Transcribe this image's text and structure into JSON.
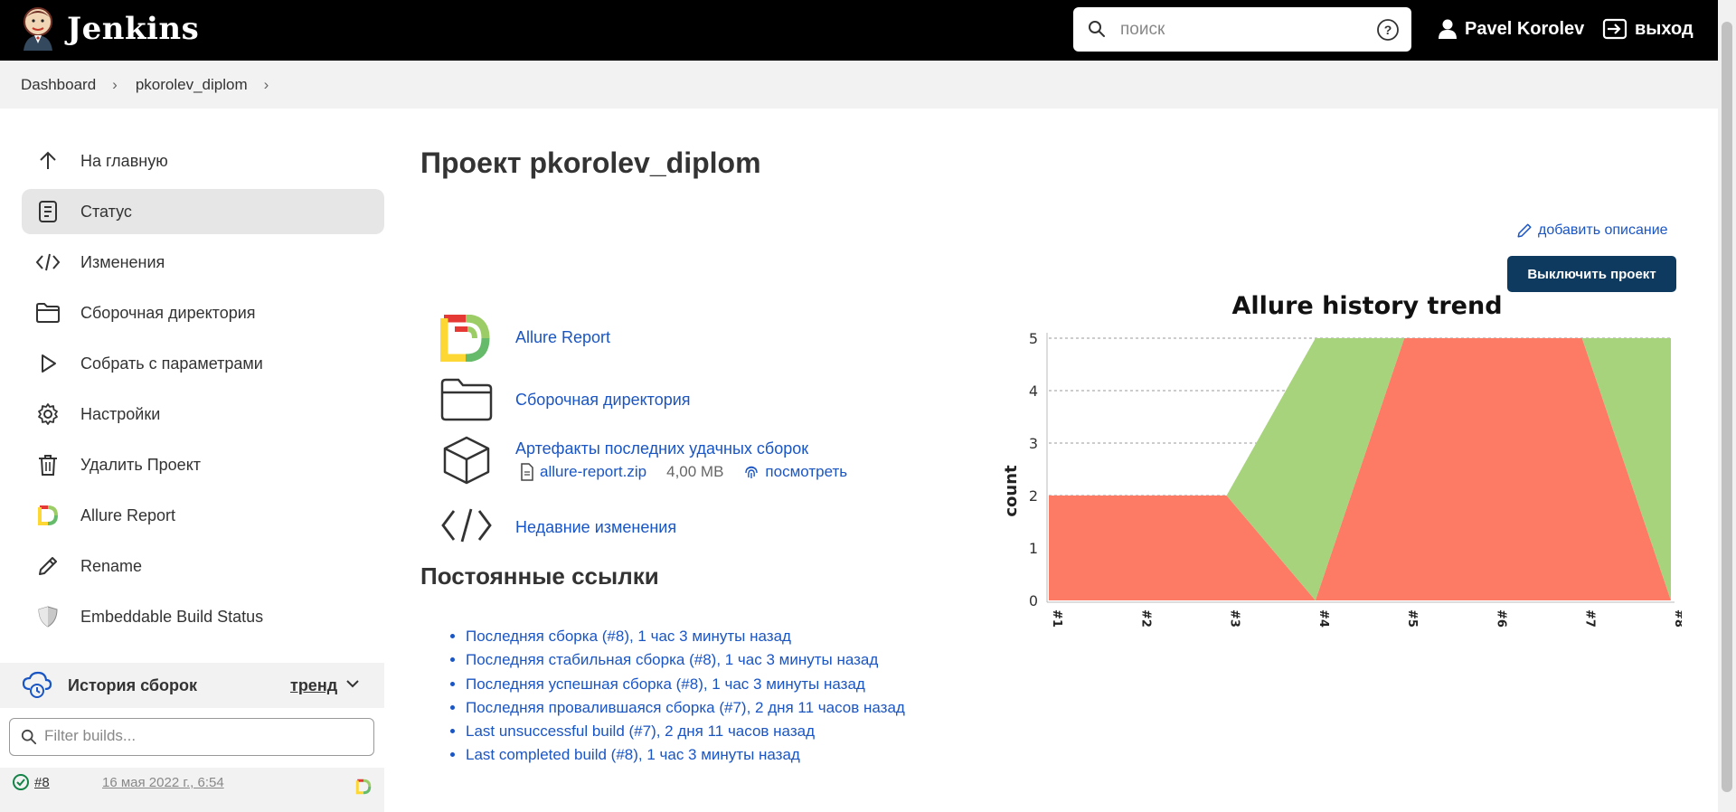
{
  "header": {
    "app_name": "Jenkins",
    "search_placeholder": "поиск",
    "user_name": "Pavel Korolev",
    "logout_label": "выход"
  },
  "breadcrumb": {
    "items": [
      "Dashboard",
      "pkorolev_diplom"
    ]
  },
  "sidebar": {
    "items": [
      {
        "label": "На главную",
        "icon": "arrow-up-icon"
      },
      {
        "label": "Статус",
        "icon": "document-icon"
      },
      {
        "label": "Изменения",
        "icon": "code-icon"
      },
      {
        "label": "Сборочная директория",
        "icon": "folder-icon"
      },
      {
        "label": "Собрать с параметрами",
        "icon": "play-icon"
      },
      {
        "label": "Настройки",
        "icon": "gear-icon"
      },
      {
        "label": "Удалить Проект",
        "icon": "trash-icon"
      },
      {
        "label": "Allure Report",
        "icon": "allure-icon"
      },
      {
        "label": "Rename",
        "icon": "pencil-icon"
      },
      {
        "label": "Embeddable Build Status",
        "icon": "shield-icon"
      }
    ],
    "history": {
      "title": "История сборок",
      "trend_label": "тренд",
      "filter_placeholder": "Filter builds...",
      "builds": [
        {
          "number": "#8",
          "date": "16 мая 2022 г., 6:54"
        }
      ]
    }
  },
  "main": {
    "title": "Проект pkorolev_diplom",
    "add_description": "добавить описание",
    "disable_button": "Выключить проект",
    "links": [
      {
        "label": "Allure Report",
        "icon": "allure-icon"
      },
      {
        "label": "Сборочная директория",
        "icon": "folder-icon"
      },
      {
        "label": "Артефакты последних удачных сборок",
        "icon": "package-icon"
      },
      {
        "label": "Недавние изменения",
        "icon": "code-icon"
      }
    ],
    "artifact": {
      "file": "allure-report.zip",
      "size": "4,00 MB",
      "view_label": "посмотреть"
    },
    "permalinks_title": "Постоянные ссылки",
    "permalinks": [
      "Последняя сборка (#8), 1 час 3 минуты назад",
      "Последняя стабильная сборка (#8), 1 час 3 минуты назад",
      "Последняя успешная сборка (#8), 1 час 3 минуты назад",
      "Последняя провалившаяся сборка (#7), 2 дня 11 часов назад",
      "Last unsuccessful build (#7), 2 дня 11 часов назад",
      "Last completed build (#8), 1 час 3 минуты назад"
    ]
  },
  "chart_data": {
    "type": "area",
    "title": "Allure history trend",
    "xlabel": "",
    "ylabel": "count",
    "categories": [
      "#1",
      "#2",
      "#3",
      "#4",
      "#5",
      "#6",
      "#7",
      "#8"
    ],
    "ylim": [
      0,
      5
    ],
    "yticks": [
      0,
      1,
      2,
      3,
      4,
      5
    ],
    "grid": true,
    "stacked": true,
    "series": [
      {
        "color": "#fd7b65",
        "values": [
          2,
          2,
          2,
          0,
          5,
          5,
          5,
          0
        ]
      },
      {
        "color": "#a7d37c",
        "values": [
          0,
          0,
          0,
          5,
          0,
          0,
          0,
          5
        ]
      }
    ]
  },
  "colors": {
    "header_bg": "#000000",
    "link": "#1a55c4",
    "primary_button": "#0f3a5f",
    "failed": "#fd7b65",
    "passed": "#a7d37c"
  }
}
